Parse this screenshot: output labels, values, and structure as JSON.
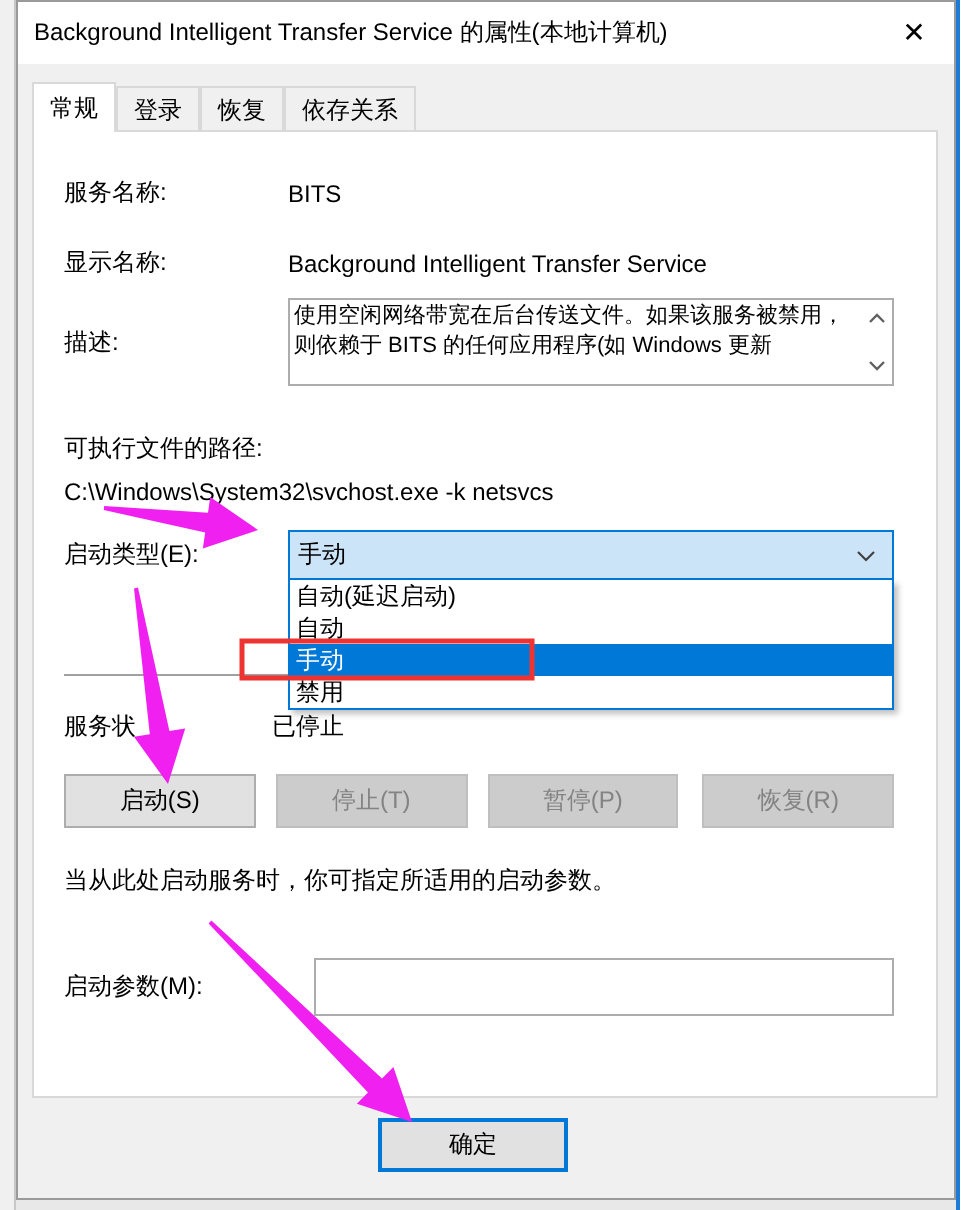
{
  "window": {
    "title": "Background Intelligent Transfer Service 的属性(本地计算机)",
    "close": "✕"
  },
  "tabs": [
    {
      "label": "常规",
      "selected": true
    },
    {
      "label": "登录",
      "selected": false
    },
    {
      "label": "恢复",
      "selected": false
    },
    {
      "label": "依存关系",
      "selected": false
    }
  ],
  "service_name": {
    "label": "服务名称:",
    "value": "BITS"
  },
  "display_name": {
    "label": "显示名称:",
    "value": "Background Intelligent Transfer Service"
  },
  "description": {
    "label": "描述:",
    "value": "使用空闲网络带宽在后台传送文件。如果该服务被禁用，则依赖于 BITS 的任何应用程序(如 Windows 更新"
  },
  "executable_path": {
    "label": "可执行文件的路径:",
    "value": "C:\\Windows\\System32\\svchost.exe -k netsvcs"
  },
  "startup_type": {
    "label": "启动类型(E):",
    "value": "手动",
    "expanded": true,
    "options": [
      {
        "label": "自动(延迟启动)",
        "selected": false
      },
      {
        "label": "自动",
        "selected": false
      },
      {
        "label": "手动",
        "selected": true
      },
      {
        "label": "禁用",
        "selected": false
      }
    ]
  },
  "service_status": {
    "label": "服务状",
    "value": "已停止"
  },
  "service_buttons": [
    {
      "label": "启动(S)",
      "disabled": false
    },
    {
      "label": "停止(T)",
      "disabled": true
    },
    {
      "label": "暂停(P)",
      "disabled": true
    },
    {
      "label": "恢复(R)",
      "disabled": true
    }
  ],
  "hint": "当从此处启动服务时，你可指定所适用的启动参数。",
  "start_parameters": {
    "label": "启动参数(M):"
  },
  "dialog_buttons": [
    "确定"
  ]
}
